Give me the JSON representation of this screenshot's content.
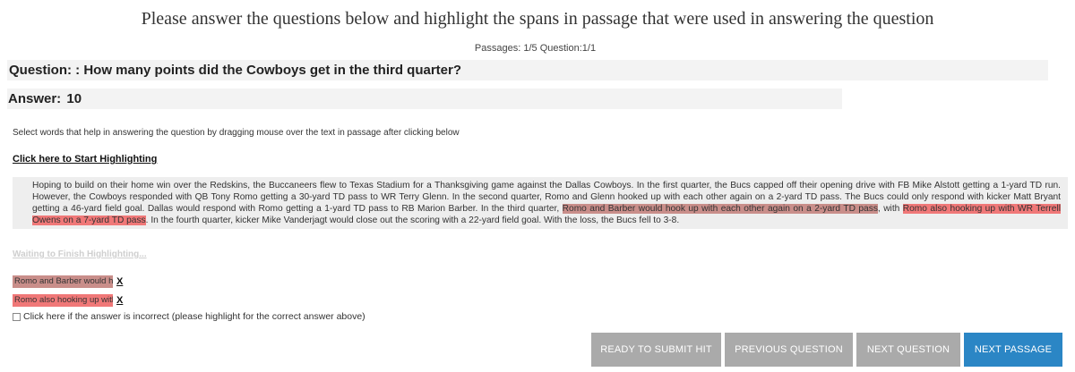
{
  "header": {
    "title": "Please answer the questions below and highlight the spans in passage that were used in answering the question",
    "progress": "Passages: 1/5 Question:1/1"
  },
  "question": {
    "prefix": "Question: :",
    "text": "How many points did the Cowboys get in the third quarter?"
  },
  "answer": {
    "prefix": "Answer:",
    "value": "10"
  },
  "instructions": "Select words that help in answering the question by dragging mouse over the text in passage after clicking below",
  "start_link": "Click here to Start Highlighting",
  "passage": {
    "before": "Hoping to build on their home win over the Redskins, the Buccaneers flew to Texas Stadium for a Thanksgiving game against the Dallas Cowboys. In the first quarter, the Bucs capped off their opening drive with FB Mike Alstott getting a 1-yard TD run. However, the Cowboys responded with QB Tony Romo getting a 30-yard TD pass to WR Terry Glenn. In the second quarter, Romo and Glenn hooked up with each other again on a 2-yard TD pass. The Bucs could only respond with kicker Matt Bryant getting a 46-yard field goal. Dallas would respond with Romo getting a 1-yard TD pass to RB Marion Barber. In the third quarter, ",
    "highlight_1": "Romo and Barber would hook up with each other again on a 2-yard TD pass",
    "middle": ", with ",
    "highlight_2": "Romo also hooking up with WR Terrell Owens on a 7-yard TD pass",
    "after": ". In the fourth quarter, kicker Mike Vanderjagt would close out the scoring with a 22-yard field goal. With the loss, the Bucs fell to 3-8."
  },
  "waiting_link": "Waiting to Finish Highlighting...",
  "selected_spans": [
    {
      "text": "Romo and Barber would hook up with each other again on a 2-yard TD pass",
      "remove": "X"
    },
    {
      "text": "Romo also hooking up with WR Terrell Owens on a 7-yard TD pass",
      "remove": "X"
    }
  ],
  "incorrect_label": "Click here if the answer is incorrect (please highlight for the correct answer above)",
  "buttons": {
    "submit": "Ready to Submit HIT",
    "previous": "Previous Question",
    "next_question": "Next Question",
    "next_passage": "Next Passage"
  },
  "colors": {
    "highlight_1": "#c98e8a",
    "highlight_2": "#f07878",
    "button_gray": "#aaaaaa",
    "button_blue": "#2b86c5"
  }
}
